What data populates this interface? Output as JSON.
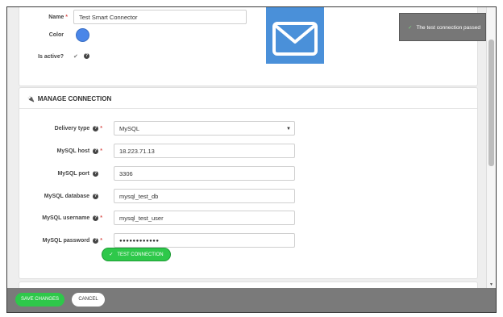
{
  "general": {
    "name_label": "Name",
    "name_value": "Test Smart Connector",
    "color_label": "Color",
    "color_value": "#4a86e8",
    "active_label": "Is active?",
    "active_check": "✔",
    "help_glyph": "?",
    "required_mark": "*",
    "icon": "envelope-icon"
  },
  "manage": {
    "title": "MANAGE CONNECTION",
    "title_icon": "plug-icon",
    "fields": {
      "delivery_type": {
        "label": "Delivery type",
        "value": "MySQL"
      },
      "host": {
        "label": "MySQL host",
        "value": "18.223.71.13"
      },
      "port": {
        "label": "MySQL port",
        "value": "3306"
      },
      "database": {
        "label": "MySQL database",
        "value": "mysql_test_db"
      },
      "username": {
        "label": "MySQL username",
        "value": "mysql_test_user"
      },
      "password": {
        "label": "MySQL password",
        "value": "●●●●●●●●●●●●"
      }
    },
    "test_button": "TEST CONNECTION",
    "test_button_check": "✓"
  },
  "toast": {
    "check": "✓",
    "message": "The test connection passed"
  },
  "footer": {
    "save_label": "SAVE CHANGES",
    "cancel_label": "CANCEL"
  },
  "colors": {
    "accent_green": "#2ec84a",
    "mail_blue": "#4a90d9",
    "footer_gray": "#7a7a7a"
  }
}
